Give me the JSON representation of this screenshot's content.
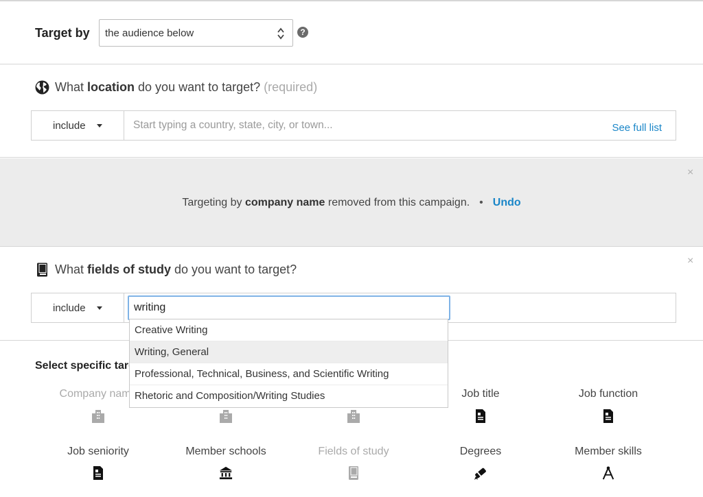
{
  "target": {
    "label": "Target by",
    "select_value": "the audience below",
    "help": "?"
  },
  "location": {
    "question_prefix": "What ",
    "question_bold": "location",
    "question_suffix": " do you want to target? ",
    "required": "(required)",
    "include_label": "include",
    "placeholder": "Start typing a country, state, city, or town...",
    "see_full_list": "See full list"
  },
  "banner": {
    "prefix": "Targeting by ",
    "bold": "company name",
    "suffix": " removed from this campaign.",
    "dot": "•",
    "undo": "Undo",
    "close": "×"
  },
  "fields_of_study": {
    "question_prefix": "What ",
    "question_bold": "fields of study",
    "question_suffix": " do you want to target?",
    "include_label": "include",
    "input_value": "writing",
    "close": "×"
  },
  "dropdown": {
    "items": [
      "Creative Writing",
      "Writing, General",
      "Professional, Technical, Business, and Scientific Writing",
      "Rhetoric and Composition/Writing Studies"
    ],
    "active_index": 1
  },
  "specific": {
    "title": "Select specific targeting",
    "options_row1": [
      {
        "label": "Company name",
        "icon": "building-icon",
        "enabled": false
      },
      {
        "label": "",
        "icon": "building-icon",
        "enabled": false
      },
      {
        "label": "",
        "icon": "building-icon",
        "enabled": false
      },
      {
        "label": "Job title",
        "icon": "document-icon",
        "enabled": true
      },
      {
        "label": "Job function",
        "icon": "document-icon",
        "enabled": true
      }
    ],
    "options_row2": [
      {
        "label": "Job seniority",
        "icon": "document-icon",
        "enabled": true
      },
      {
        "label": "Member schools",
        "icon": "school-icon",
        "enabled": true
      },
      {
        "label": "Fields of study",
        "icon": "book-icon",
        "enabled": false
      },
      {
        "label": "Degrees",
        "icon": "diploma-icon",
        "enabled": true
      },
      {
        "label": "Member skills",
        "icon": "compass-icon",
        "enabled": true
      }
    ]
  },
  "colors": {
    "link": "#1a86c8",
    "banner_bg": "#ececec",
    "focus_border": "#7fb3e6"
  }
}
